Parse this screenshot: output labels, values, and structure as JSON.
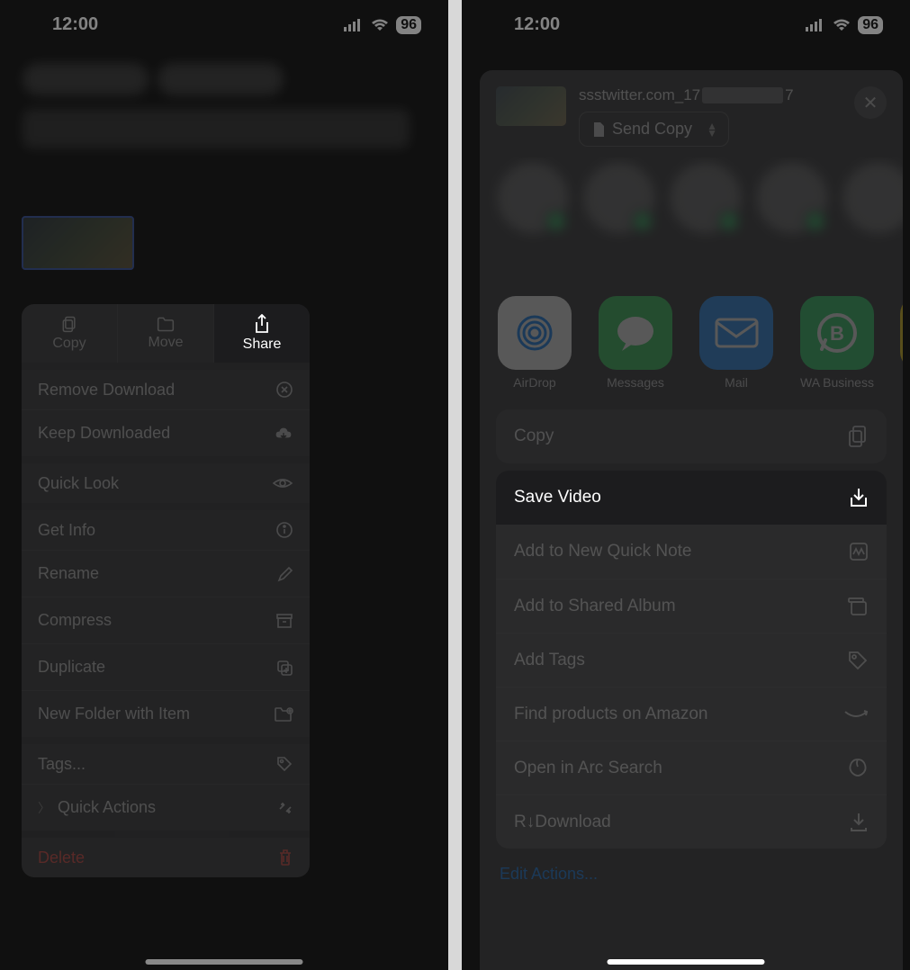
{
  "status": {
    "time": "12:00",
    "battery": "96"
  },
  "left": {
    "top_actions": {
      "copy": "Copy",
      "move": "Move",
      "share": "Share"
    },
    "rows": {
      "remove_download": "Remove Download",
      "keep_downloaded": "Keep Downloaded",
      "quick_look": "Quick Look",
      "get_info": "Get Info",
      "rename": "Rename",
      "compress": "Compress",
      "duplicate": "Duplicate",
      "new_folder": "New Folder with Item",
      "tags": "Tags...",
      "quick_actions": "Quick Actions",
      "delete": "Delete"
    }
  },
  "right": {
    "filename_prefix": "ssstwitter.com_17",
    "filename_suffix": "7",
    "send_copy": "Send Copy",
    "apps": {
      "airdrop": "AirDrop",
      "messages": "Messages",
      "mail": "Mail",
      "wab": "WA Business"
    },
    "actions": {
      "copy": "Copy",
      "save_video": "Save Video",
      "quick_note": "Add to New Quick Note",
      "shared_album": "Add to Shared Album",
      "add_tags": "Add Tags",
      "amazon": "Find products on Amazon",
      "arc": "Open in Arc Search",
      "rdownload": "R↓Download",
      "edit": "Edit Actions..."
    }
  }
}
